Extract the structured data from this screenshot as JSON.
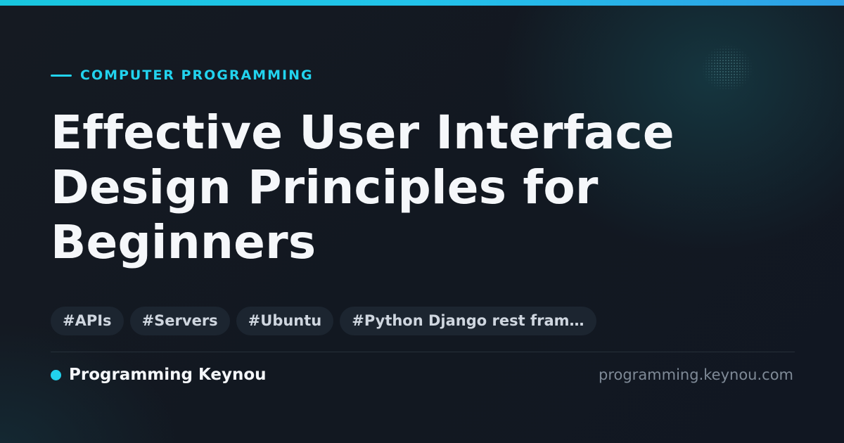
{
  "colors": {
    "accent": "#22d3ee",
    "background": "#121820",
    "title_text": "#f5f7fa",
    "tag_background": "#1c2530",
    "tag_text": "#cfd6df",
    "muted_text": "#7f8a97"
  },
  "category": {
    "label": "COMPUTER PROGRAMMING"
  },
  "title": "Effective User Interface Design Principles for Beginners",
  "tags": [
    "#APIs",
    "#Servers",
    "#Ubuntu",
    "#Python Django rest fram…"
  ],
  "footer": {
    "brand_name": "Programming Keynou",
    "url": "programming.keynou.com"
  }
}
